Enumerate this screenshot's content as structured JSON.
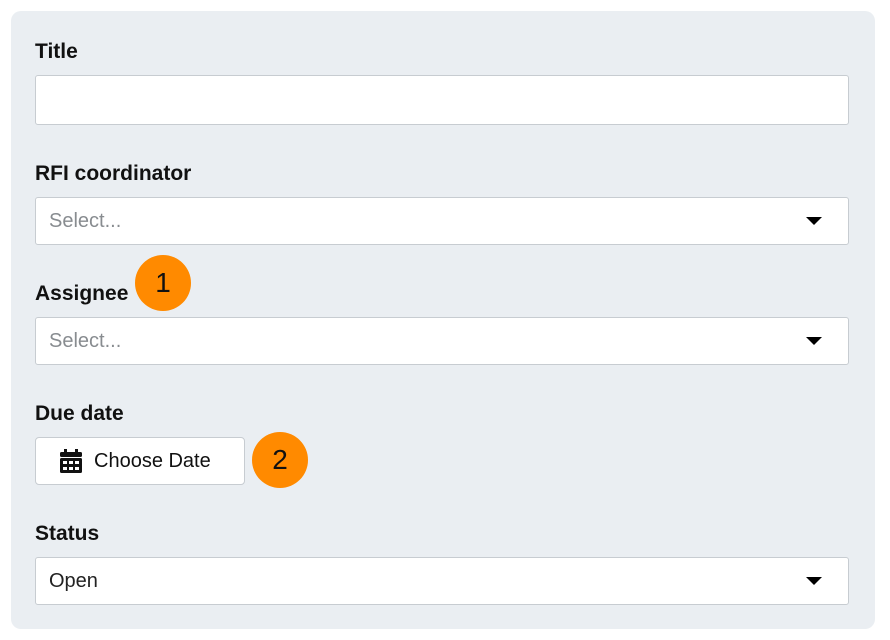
{
  "form": {
    "title": {
      "label": "Title",
      "value": "",
      "placeholder": ""
    },
    "rfi_coordinator": {
      "label": "RFI coordinator",
      "placeholder": "Select..."
    },
    "assignee": {
      "label": "Assignee",
      "placeholder": "Select..."
    },
    "due_date": {
      "label": "Due date",
      "button_label": "Choose Date",
      "icon": "calendar-icon"
    },
    "status": {
      "label": "Status",
      "value": "Open"
    }
  },
  "annotations": [
    {
      "number": "1"
    },
    {
      "number": "2"
    }
  ],
  "colors": {
    "panel_background": "#eaeef2",
    "badge": "#ff8a00",
    "placeholder_text": "#888c90",
    "border": "#c7ccd1"
  }
}
